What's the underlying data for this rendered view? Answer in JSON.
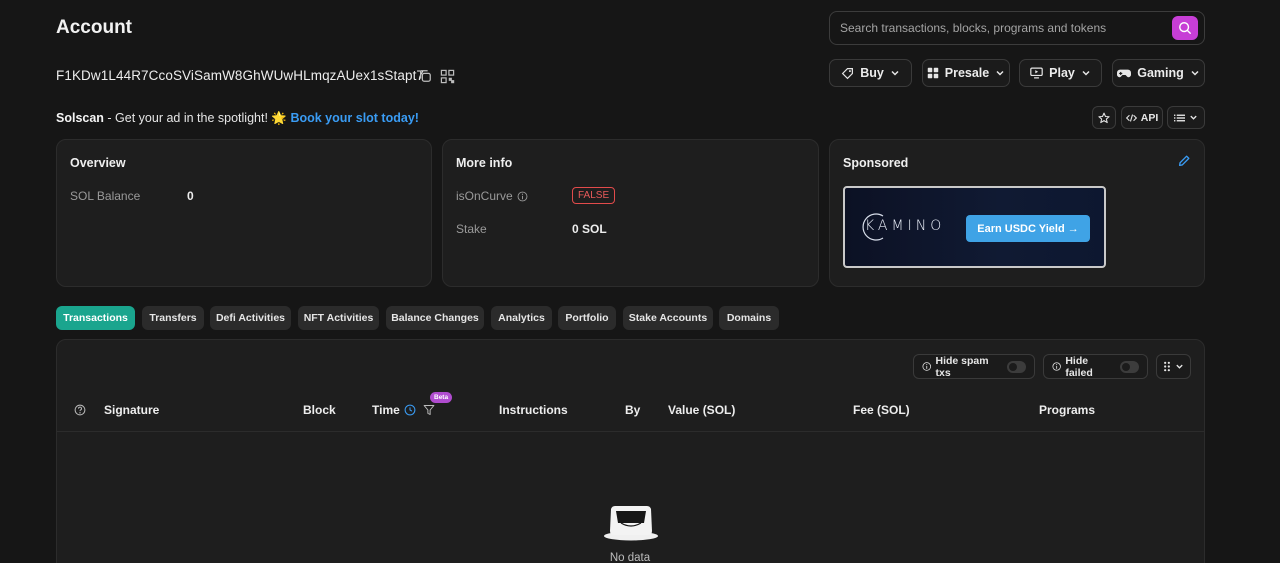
{
  "page": {
    "title": "Account"
  },
  "search": {
    "placeholder": "Search transactions, blocks, programs and tokens"
  },
  "account": {
    "address": "F1KDw1L44R7CcoSViSamW8GhWUwHLmqzAUex1sStapt7"
  },
  "nav_menus": [
    {
      "label": "Buy"
    },
    {
      "label": "Presale"
    },
    {
      "label": "Play"
    },
    {
      "label": "Gaming"
    }
  ],
  "promo": {
    "brand": "Solscan",
    "text": " - Get your ad in the spotlight! ",
    "emoji": "🌟",
    "link": "Book your slot today!"
  },
  "toolbar": {
    "api_label": "API"
  },
  "overview": {
    "title": "Overview",
    "sol_balance_label": "SOL Balance",
    "sol_balance_value": "0"
  },
  "more_info": {
    "title": "More info",
    "is_on_curve_label": "isOnCurve",
    "is_on_curve_value": "FALSE",
    "stake_label": "Stake",
    "stake_value": "0 SOL"
  },
  "sponsored": {
    "title": "Sponsored",
    "ad_logo": "KAMINO",
    "ad_cta": "Earn USDC Yield →"
  },
  "tabs": [
    {
      "label": "Transactions",
      "active": true
    },
    {
      "label": "Transfers"
    },
    {
      "label": "Defi Activities"
    },
    {
      "label": "NFT Activities"
    },
    {
      "label": "Balance Changes"
    },
    {
      "label": "Analytics"
    },
    {
      "label": "Portfolio"
    },
    {
      "label": "Stake Accounts"
    },
    {
      "label": "Domains"
    }
  ],
  "filters": {
    "hide_spam": "Hide spam txs",
    "hide_failed": "Hide failed"
  },
  "table": {
    "columns": [
      "Signature",
      "Block",
      "Time",
      "Instructions",
      "By",
      "Value (SOL)",
      "Fee (SOL)",
      "Programs"
    ],
    "beta_badge": "Beta",
    "empty_text": "No data"
  },
  "colors": {
    "background": "#161616",
    "accent_tab": "#1aa58e",
    "search_button": "#c73ed6",
    "link": "#3a9cf4",
    "false_badge": "#e24b4b"
  }
}
